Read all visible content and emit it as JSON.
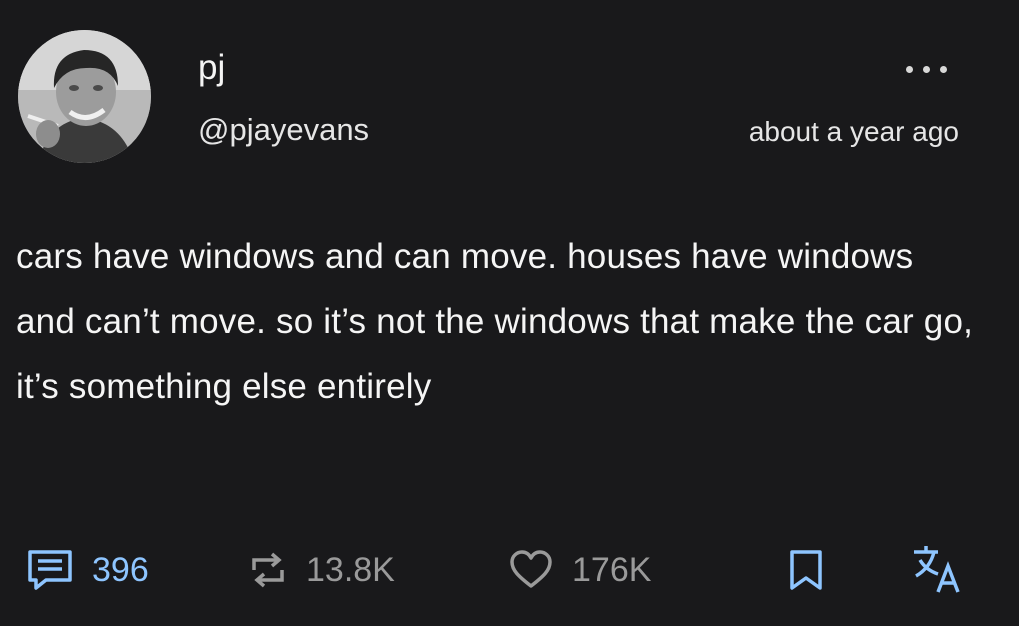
{
  "post": {
    "display_name": "pj",
    "handle": "@pjayevans",
    "timestamp": "about a year ago",
    "avatar_icon": "avatar-photo",
    "more_icon": "more-horizontal-icon",
    "text": "cars have windows and can move. houses have windows and can’t move. so it’s not the windows that make the car go, it’s something else entirely"
  },
  "actions": {
    "reply": {
      "icon": "comment-icon",
      "count": "396"
    },
    "retweet": {
      "icon": "retweet-icon",
      "count": "13.8K"
    },
    "like": {
      "icon": "heart-icon",
      "count": "176K"
    },
    "bookmark": {
      "icon": "bookmark-icon"
    },
    "translate": {
      "icon": "translate-icon"
    }
  },
  "colors": {
    "background": "#19191b",
    "text": "#f5f5f5",
    "accent": "#8ec5ff",
    "muted": "#9a9a9a"
  }
}
